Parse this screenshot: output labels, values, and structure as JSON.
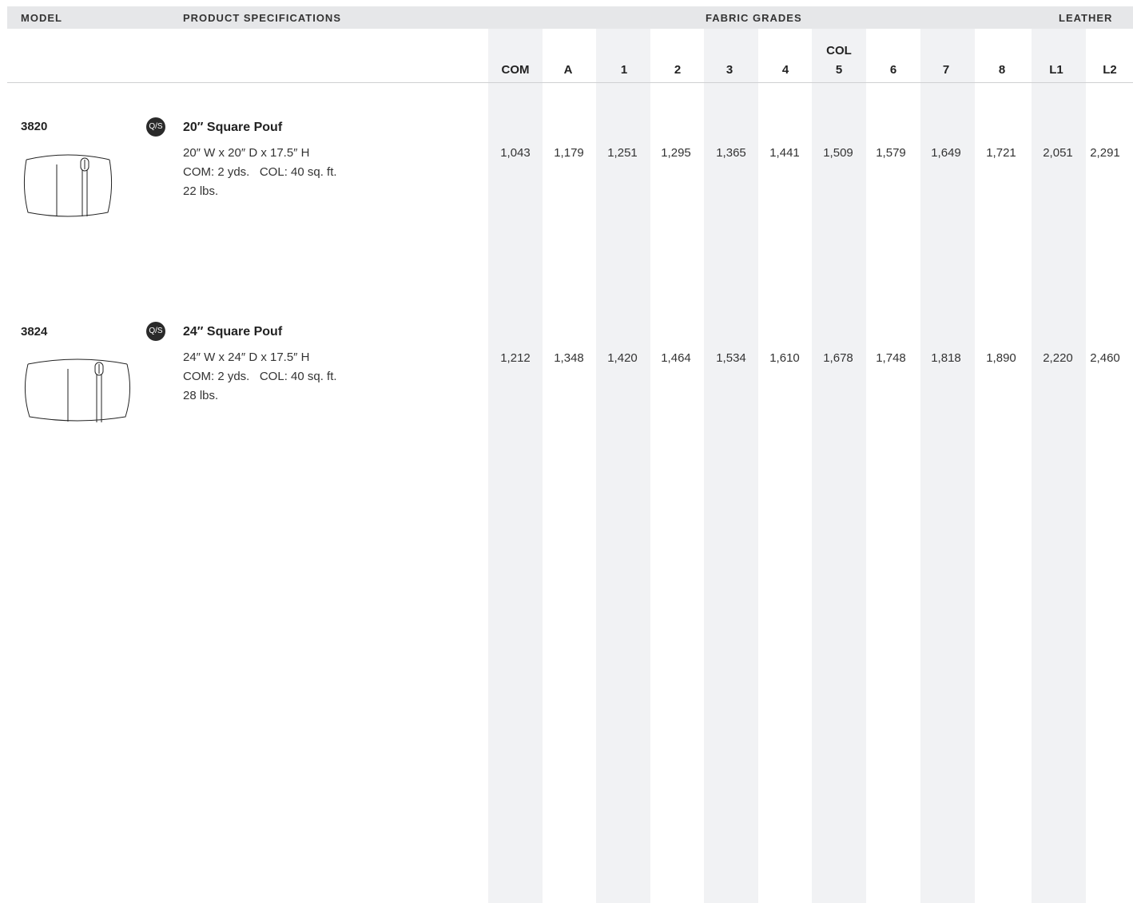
{
  "header": {
    "model": "MODEL",
    "specs": "PRODUCT SPECIFICATIONS",
    "fabric": "FABRIC GRADES",
    "leather": "LEATHER"
  },
  "columns": [
    "COM",
    "A",
    "1",
    "2",
    "3",
    "4",
    "5",
    "6",
    "7",
    "8",
    "L1",
    "L2"
  ],
  "col_label": "COL",
  "rows": [
    {
      "model": "3820",
      "badge": "Q/S",
      "name": "20″ Square Pouf",
      "dims": "20″ W x 20″ D x 17.5″ H",
      "com": "COM: 2 yds.   COL: 40 sq. ft.",
      "weight": "22 lbs.",
      "prices": [
        "1,043",
        "1,179",
        "1,251",
        "1,295",
        "1,365",
        "1,441",
        "1,509",
        "1,579",
        "1,649",
        "1,721",
        "2,051",
        "2,291"
      ]
    },
    {
      "model": "3824",
      "badge": "Q/S",
      "name": "24″ Square Pouf",
      "dims": "24″ W x 24″ D x 17.5″ H",
      "com": "COM: 2 yds.   COL: 40 sq. ft.",
      "weight": "28 lbs.",
      "prices": [
        "1,212",
        "1,348",
        "1,420",
        "1,464",
        "1,534",
        "1,610",
        "1,678",
        "1,748",
        "1,818",
        "1,890",
        "2,220",
        "2,460"
      ]
    }
  ]
}
